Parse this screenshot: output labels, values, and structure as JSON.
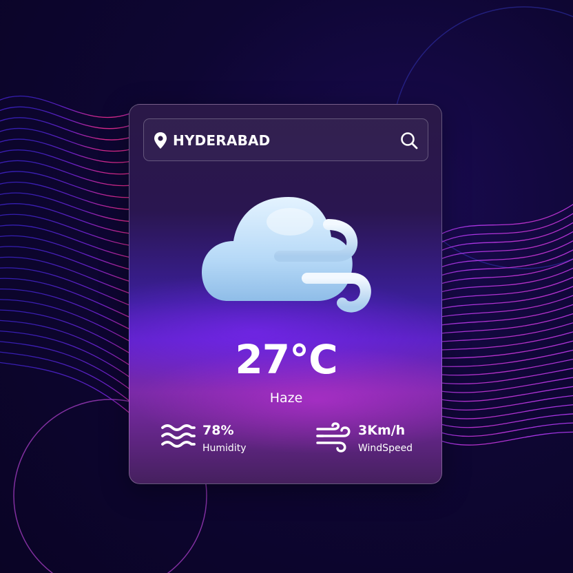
{
  "search": {
    "city_value": "HYDERABAD",
    "pin_icon": "map-pin-icon",
    "search_icon": "search-icon"
  },
  "weather": {
    "icon": "cloud-wind-icon",
    "temperature": "27°C",
    "condition": "Haze"
  },
  "stats": {
    "humidity": {
      "value": "78%",
      "label": "Humidity",
      "icon": "waves-icon"
    },
    "wind": {
      "value": "3Km/h",
      "label": "WindSpeed",
      "icon": "wind-icon"
    }
  },
  "colors": {
    "text": "#ffffff",
    "cloud": "#b6d9f7",
    "accent_purple": "#7b2aff",
    "accent_magenta": "#e02fd6",
    "background": "#0e0633"
  }
}
